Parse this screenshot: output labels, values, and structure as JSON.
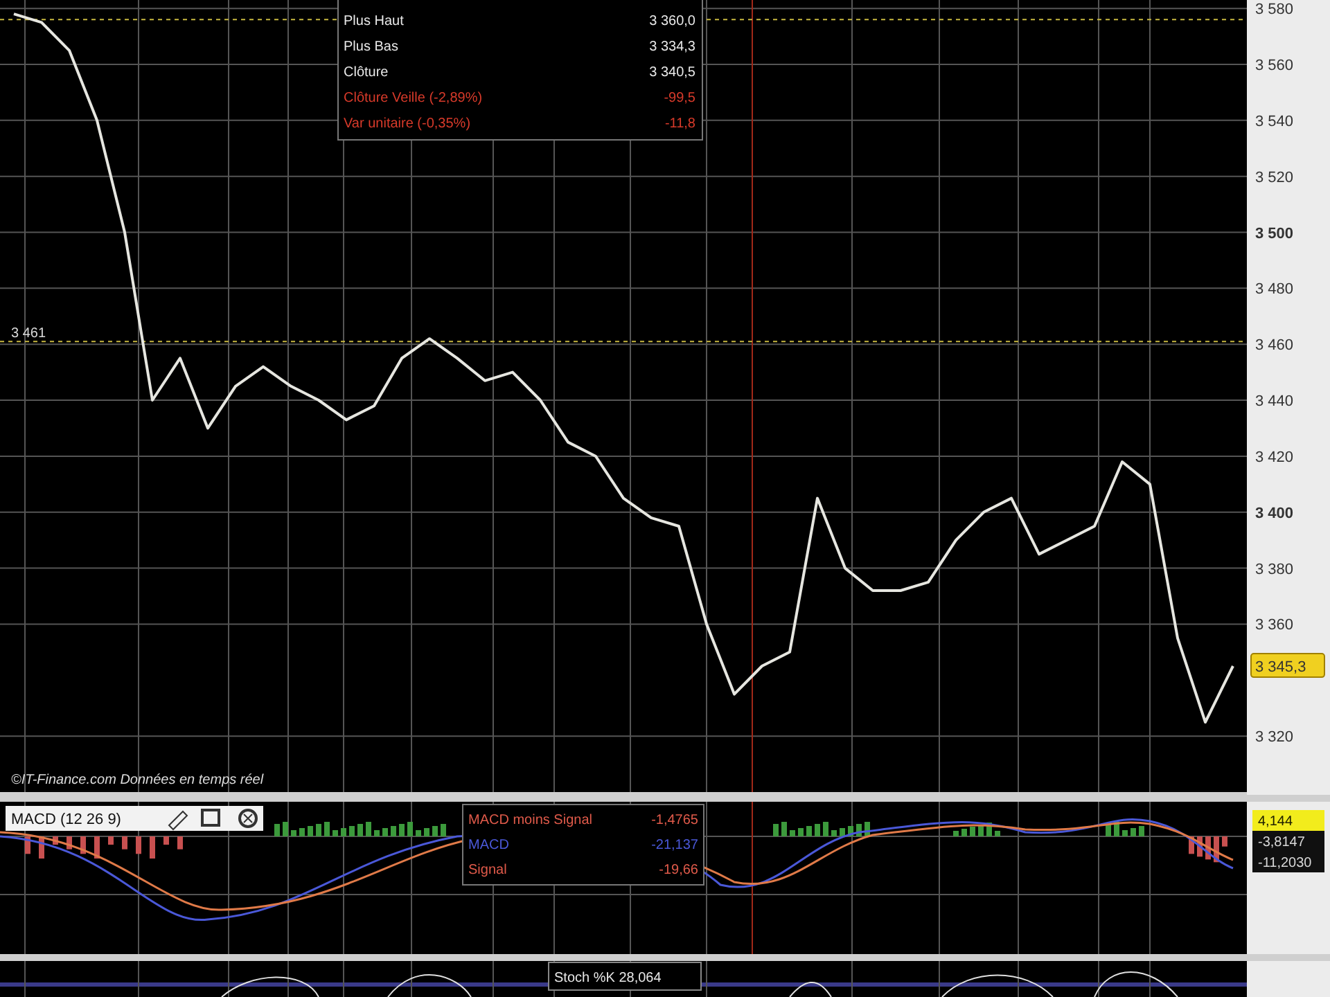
{
  "price_chart": {
    "chart_data": {
      "type": "line",
      "series": [
        {
          "color": "#e6e6e0",
          "values": [
            3578,
            3575,
            3565,
            3540,
            3500,
            3440,
            3455,
            3430,
            3445,
            3452,
            3445,
            3440,
            3433,
            3438,
            3455,
            3462,
            3455,
            3447,
            3450,
            3440,
            3425,
            3420,
            3405,
            3398,
            3395,
            3360,
            3335,
            3345,
            3350,
            3405,
            3380,
            3372,
            3372,
            3375,
            3390,
            3400,
            3405,
            3385,
            3390,
            3395,
            3418,
            3410,
            3355,
            3325,
            3345
          ]
        }
      ],
      "ylim": [
        3300,
        3583
      ],
      "grid": true,
      "ref_lines": [
        {
          "axis": "y",
          "value": 3576
        },
        {
          "axis": "y",
          "value": 3461,
          "label": "3 461"
        }
      ],
      "yticks": [
        {
          "value": 3580,
          "label": "3 580"
        },
        {
          "value": 3560,
          "label": "3 560"
        },
        {
          "value": 3540,
          "label": "3 540"
        },
        {
          "value": 3520,
          "label": "3 520"
        },
        {
          "value": 3500,
          "label": "3 500"
        },
        {
          "value": 3480,
          "label": "3 480"
        },
        {
          "value": 3460,
          "label": "3 460"
        },
        {
          "value": 3440,
          "label": "3 440"
        },
        {
          "value": 3420,
          "label": "3 420"
        },
        {
          "value": 3400,
          "label": "3 400"
        },
        {
          "value": 3380,
          "label": "3 380"
        },
        {
          "value": 3360,
          "label": "3 360"
        },
        {
          "value": 3320,
          "label": "3 320"
        }
      ]
    },
    "last_price": "3 345,3",
    "tooltip": [
      {
        "label": "Plus Haut",
        "value": "3 360,0",
        "kind": "normal"
      },
      {
        "label": "Plus Bas",
        "value": "3 334,3",
        "kind": "normal"
      },
      {
        "label": "Clôture",
        "value": "3 340,5",
        "kind": "normal"
      },
      {
        "label": "Clôture Veille (-2,89%)",
        "value": "-99,5",
        "kind": "change"
      },
      {
        "label": "Var unitaire (-0,35%)",
        "value": "-11,8",
        "kind": "change"
      }
    ],
    "footer": "©IT-Finance.com  Données en temps réel"
  },
  "macd": {
    "title": "MACD (12 26 9)",
    "tooltip": [
      {
        "label": "MACD moins Signal",
        "value": "-1,4765",
        "color": "#e05a4a"
      },
      {
        "label": "MACD",
        "value": "-21,137",
        "color": "#4a58d8"
      },
      {
        "label": "Signal",
        "value": "-19,66",
        "color": "#e05a4a"
      }
    ],
    "axis_values": [
      {
        "value": "4,144",
        "kind": "highlight"
      },
      {
        "value": "-3,8147",
        "kind": "plain"
      },
      {
        "value": "-11,2030",
        "kind": "plain"
      }
    ]
  },
  "stochastic": {
    "tooltip": "Stoch %K 28,064"
  }
}
